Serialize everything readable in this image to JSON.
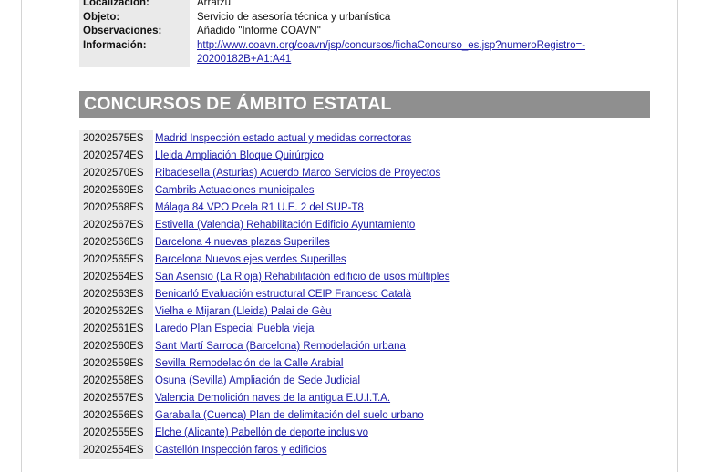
{
  "details": [
    {
      "label": "Localización:",
      "value": "Arratzu"
    },
    {
      "label": "Objeto:",
      "value": "Servicio de asesoría técnica y urbanística"
    },
    {
      "label": "Observaciones:",
      "value": "Añadido \"Informe COAVN\""
    },
    {
      "label": "Información:",
      "link_line1": "http://www.coavn.org/coavn/jsp/concursos/fichaConcurso_es.jsp?numeroRegistro=-",
      "link_line2": "20200182B+A1:A41"
    }
  ],
  "section_title": "CONCURSOS DE ÁMBITO ESTATAL",
  "contests": [
    {
      "id": "20202575ES",
      "title": "Madrid Inspección estado actual y medidas correctoras"
    },
    {
      "id": "20202574ES",
      "title": "Lleida Ampliación Bloque Quirúrgico "
    },
    {
      "id": "20202570ES",
      "title": "Ribadesella (Asturias) Acuerdo Marco Servicios de Proyectos"
    },
    {
      "id": "20202569ES",
      "title": "Cambrils Actuaciones municipales"
    },
    {
      "id": "20202568ES",
      "title": "Málaga 84 VPO Pcela R1 U.E. 2 del SUP-T8"
    },
    {
      "id": "20202567ES",
      "title": "Estivella (Valencia) Rehabilitación Edificio Ayuntamiento"
    },
    {
      "id": "20202566ES",
      "title": "Barcelona 4 nuevas plazas Superilles"
    },
    {
      "id": "20202565ES",
      "title": "Barcelona Nuevos ejes verdes Superilles"
    },
    {
      "id": "20202564ES",
      "title": "San Asensio (La Rioja) Rehabilitación edificio de usos múltiples "
    },
    {
      "id": "20202563ES",
      "title": "Benicarló Evaluación estructural CEIP Francesc Català"
    },
    {
      "id": "20202562ES",
      "title": "Vielha e Mijaran (Lleida) Palai de Gèu "
    },
    {
      "id": "20202561ES",
      "title": "Laredo Plan Especial Puebla vieja"
    },
    {
      "id": "20202560ES",
      "title": "Sant Martí Sarroca (Barcelona) Remodelación urbana "
    },
    {
      "id": "20202559ES",
      "title": "Sevilla Remodelación de la Calle Arabial"
    },
    {
      "id": "20202558ES",
      "title": "Osuna (Sevilla) Ampliación de Sede Judicial"
    },
    {
      "id": "20202557ES",
      "title": "Valencia Demolición naves de la antigua E.U.I.T.A."
    },
    {
      "id": "20202556ES",
      "title": "Garaballa (Cuenca) Plan de delimitación del suelo urbano"
    },
    {
      "id": "20202555ES",
      "title": "Elche (Alicante) Pabellón de deporte inclusivo"
    },
    {
      "id": "20202554ES",
      "title": "Castellón Inspección faros y edificios"
    }
  ]
}
